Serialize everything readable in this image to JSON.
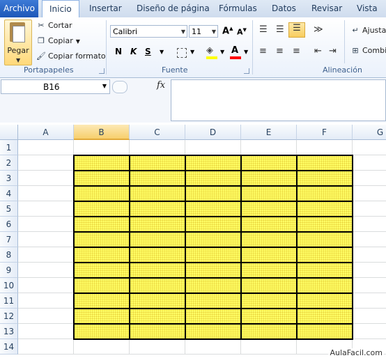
{
  "tabs": {
    "file": "Archivo",
    "items": [
      "Inicio",
      "Insertar",
      "Diseño de página",
      "Fórmulas",
      "Datos",
      "Revisar",
      "Vista"
    ],
    "active": "Inicio"
  },
  "ribbon": {
    "clipboard": {
      "paste_label": "Pegar",
      "cut_label": "Cortar",
      "copy_label": "Copiar",
      "format_painter_label": "Copiar formato",
      "group_label": "Portapapeles"
    },
    "font": {
      "font_name": "Calibri",
      "font_size": "11",
      "group_label": "Fuente",
      "fill_color": "#ffff00",
      "font_color": "#ff0000"
    },
    "alignment": {
      "wrap_label": "Ajustar",
      "merge_label": "Combi",
      "group_label": "Alineación"
    }
  },
  "formula_bar": {
    "name_box": "B16",
    "fx_label": "fx",
    "formula": ""
  },
  "sheet": {
    "columns": [
      "A",
      "B",
      "C",
      "D",
      "E",
      "F",
      "G"
    ],
    "selected_column": "B",
    "rows": [
      "1",
      "2",
      "3",
      "4",
      "5",
      "6",
      "7",
      "8",
      "9",
      "10",
      "11",
      "12",
      "13",
      "14"
    ],
    "highlight_color": "#ffff66"
  },
  "watermark": "AulaFacil.com"
}
